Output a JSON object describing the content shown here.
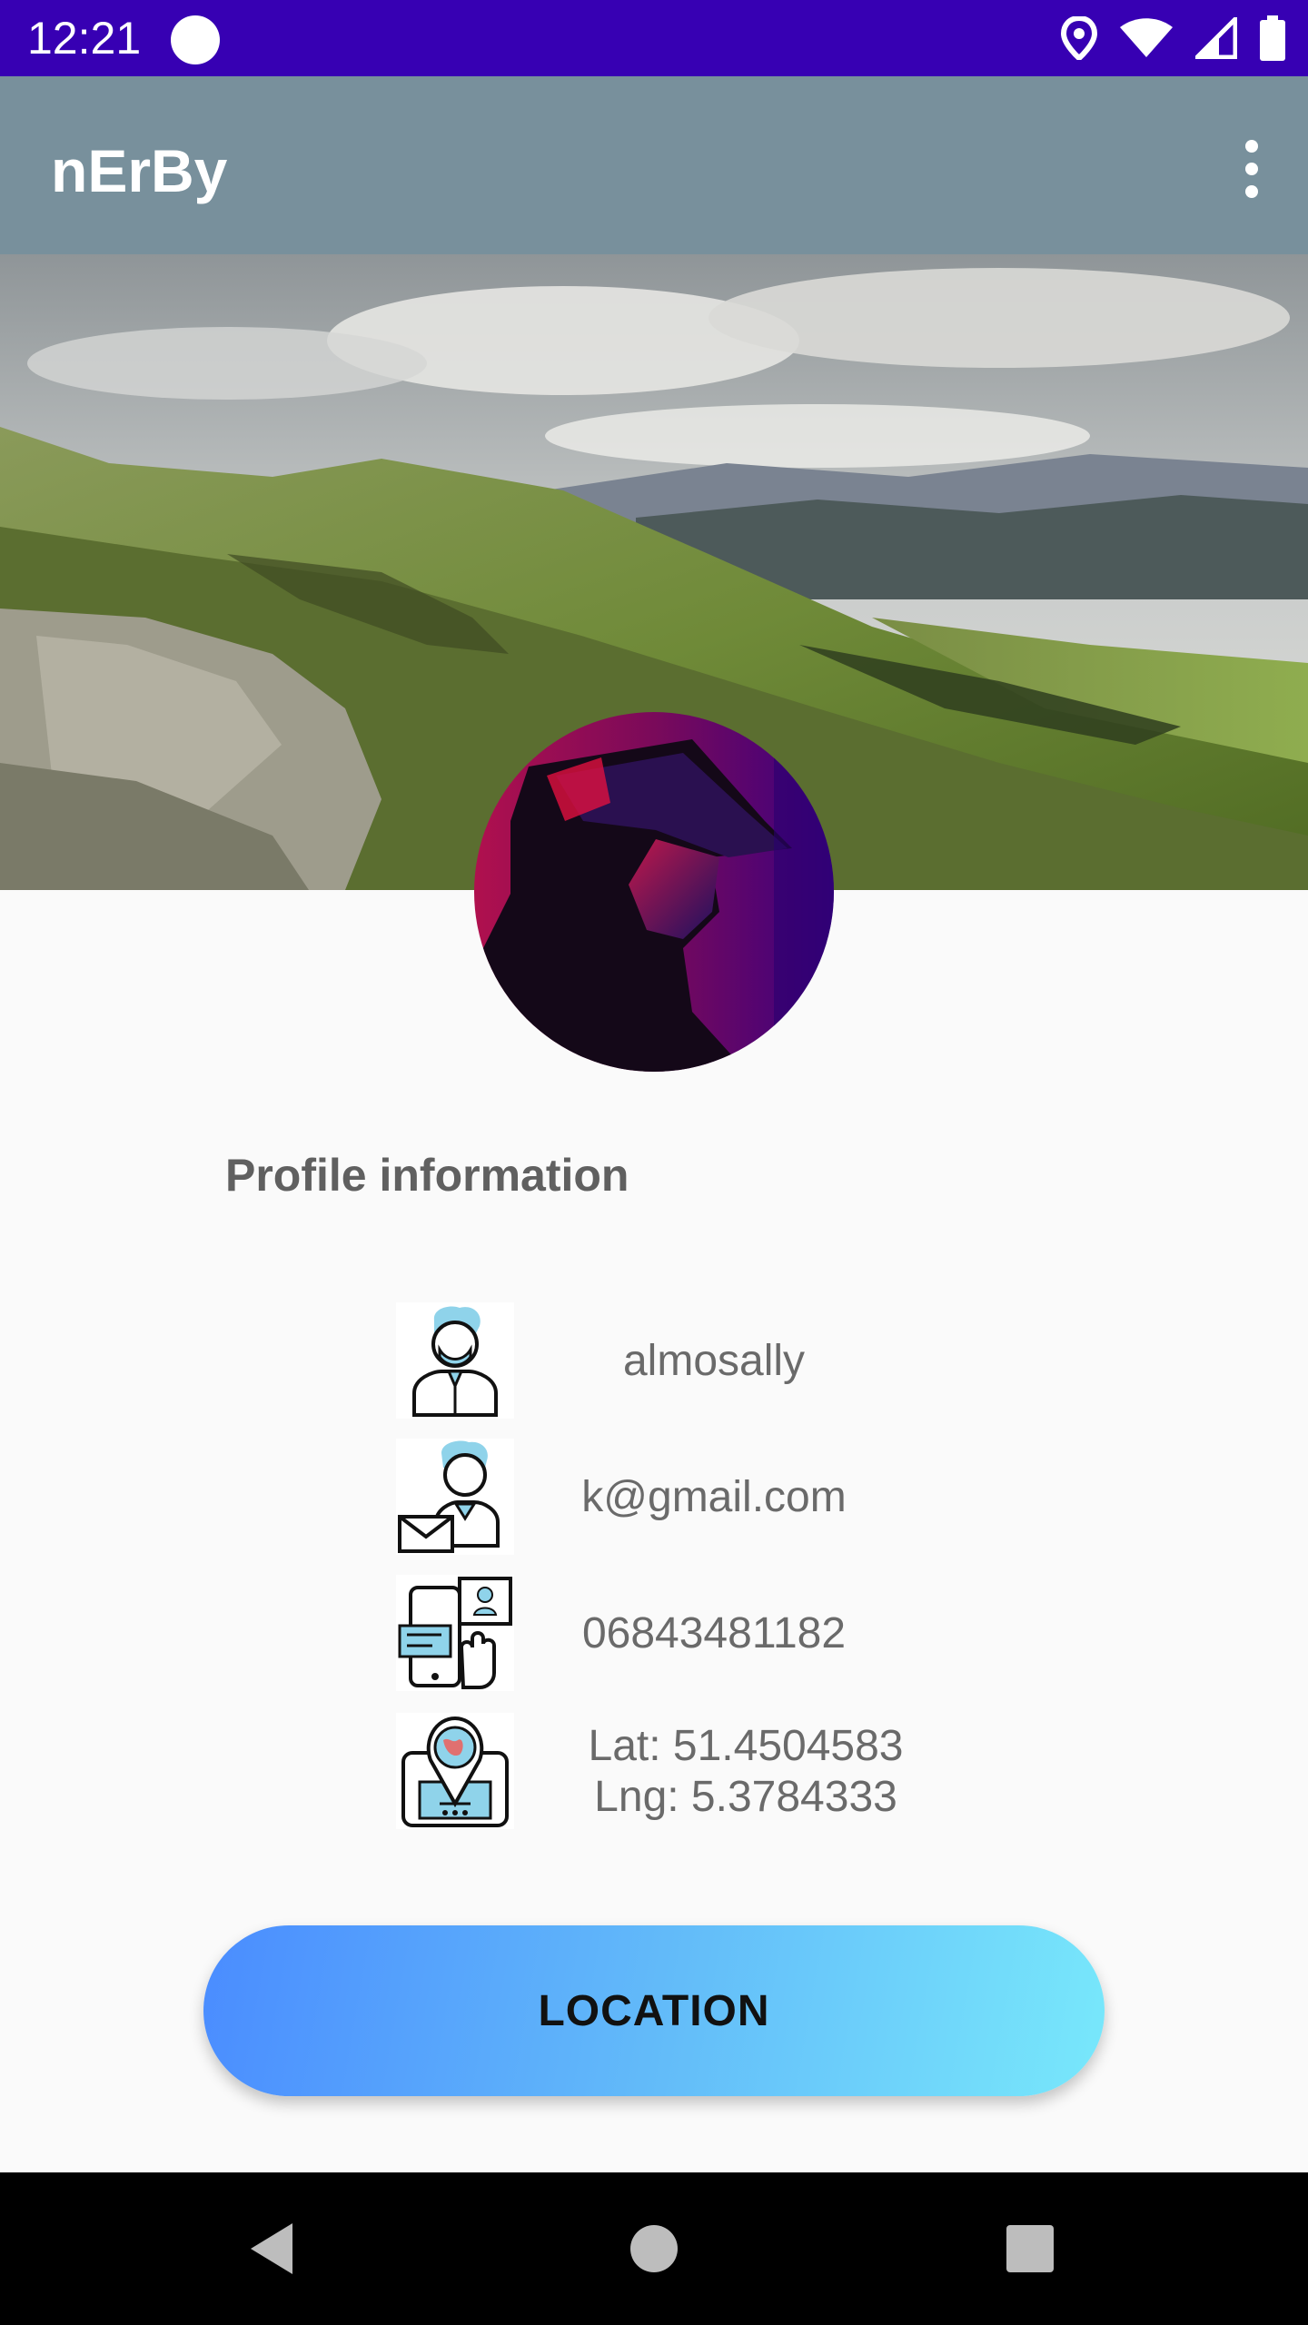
{
  "status_bar": {
    "time": "12:21",
    "icons": [
      "location-icon",
      "wifi-icon",
      "signal-icon",
      "battery-icon"
    ],
    "background": "#3700b3"
  },
  "app_bar": {
    "title": "nErBy",
    "menu_icon": "more-vert-icon",
    "background": "#78909c"
  },
  "profile": {
    "section_title": "Profile information",
    "username": "almosally",
    "email": "k@gmail.com",
    "phone": "06843481182",
    "location_lat": "Lat: 51.4504583",
    "location_lng": "Lng: 5.3784333"
  },
  "button": {
    "location_label": "LOCATION",
    "gradient": [
      "#4a8cff",
      "#78e8fb"
    ]
  },
  "nav_bar": {
    "icons": [
      "back-icon",
      "home-icon",
      "recents-icon"
    ]
  }
}
